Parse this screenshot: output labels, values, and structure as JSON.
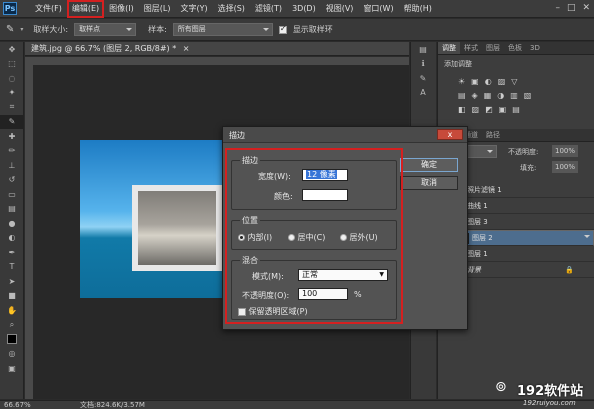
{
  "app": {
    "logo": "Ps"
  },
  "menubar": {
    "items": [
      "文件(F)",
      "编辑(E)",
      "图像(I)",
      "图层(L)",
      "文字(Y)",
      "选择(S)",
      "滤镜(T)",
      "3D(D)",
      "视图(V)",
      "窗口(W)",
      "帮助(H)"
    ],
    "highlighted_index": 1
  },
  "window_controls": {
    "minimize": "–",
    "maximize": "□",
    "close": "✕"
  },
  "options_bar": {
    "sample_size_label": "取样大小:",
    "sample_size_value": "取样点",
    "sample_label": "样本:",
    "sample_value": "所有图层",
    "show_ring_label": "显示取样环",
    "show_ring_checked": true
  },
  "document": {
    "tab_title": "建筑.jpg @ 66.7% (图层 2, RGB/8#) *",
    "tab_close": "×"
  },
  "status_bar": {
    "zoom": "66.67%",
    "doc_info": "文档:824.6K/3.57M"
  },
  "panels": {
    "adjust_tabs": [
      "调整",
      "样式",
      "图层",
      "色板",
      "3D"
    ],
    "adjust_title": "添加调整",
    "layer_tabs": [
      "图层",
      "通道",
      "路径"
    ],
    "blend_mode": "正常",
    "opacity_label": "不透明度:",
    "opacity_value": "100%",
    "fill_label": "填充:",
    "fill_value": "100%",
    "layers": [
      {
        "name": "照片滤镜 1",
        "selected": false
      },
      {
        "name": "曲线 1",
        "selected": false
      },
      {
        "name": "图层 3",
        "selected": false
      },
      {
        "name": "图层 2",
        "selected": true
      },
      {
        "name": "图层 1",
        "selected": false
      },
      {
        "name": "背景",
        "selected": false
      }
    ]
  },
  "dialog": {
    "title": "描边",
    "close_label": "x",
    "stroke_group": "描边",
    "width_label": "宽度(W):",
    "width_value": "12 像素",
    "color_label": "颜色:",
    "position_group": "位置",
    "position_options": [
      "内部(I)",
      "居中(C)",
      "居外(U)"
    ],
    "position_selected": 0,
    "blend_group": "混合",
    "mode_label": "模式(M):",
    "mode_value": "正常",
    "opacity_label": "不透明度(O):",
    "opacity_value": "100",
    "opacity_unit": "%",
    "preserve_label": "保留透明区域(P)",
    "preserve_checked": false,
    "ok_label": "确定",
    "cancel_label": "取消"
  },
  "watermark": {
    "text": "192软件站",
    "url": "192ruiyou.com"
  },
  "colors": {
    "accent_red": "#d42020",
    "ui_dark": "#3c3c3c",
    "selection_blue": "#4d6d8e"
  }
}
